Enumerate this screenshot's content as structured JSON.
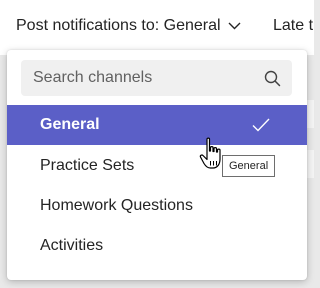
{
  "header": {
    "post_to_label": "Post notifications to: General",
    "next_label": "Late t"
  },
  "dropdown": {
    "search_placeholder": "Search channels",
    "channels": [
      {
        "label": "General",
        "selected": true
      },
      {
        "label": "Practice Sets",
        "selected": false
      },
      {
        "label": "Homework Questions",
        "selected": false
      },
      {
        "label": "Activities",
        "selected": false
      }
    ]
  },
  "tooltip": {
    "text": "General"
  },
  "colors": {
    "accent": "#5b5fc7",
    "text": "#242424",
    "search_bg": "#f0f0f0"
  },
  "icons": {
    "dropdown_chevron": "chevron-down-icon",
    "search": "search-icon",
    "selected": "checkmark-icon",
    "cursor": "hand-pointer-icon"
  }
}
